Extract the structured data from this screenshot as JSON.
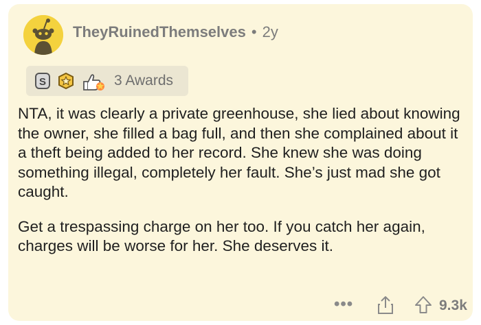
{
  "comment": {
    "author": "TheyRuinedThemselves",
    "separator": "•",
    "age": "2y",
    "awards_label": "3 Awards",
    "paragraphs": [
      "NTA, it was clearly a private greenhouse, she lied about knowing the owner, she filled a bag full, and then she complained about it a theft being added to her record. She knew she was doing something illegal, completely her fault. She’s just mad she got caught.",
      "Get a trespassing charge on her too. If you catch her again, charges will be worse for her. She deserves it."
    ],
    "more_label": "•••",
    "score": "9.3k"
  },
  "colors": {
    "card_background": "#fcf6dc",
    "avatar_background": "#f4d23e",
    "awards_background": "#ebe6d2",
    "text": "#1f1f1f",
    "meta_text": "#7c7c7c"
  },
  "icons": [
    "snoo-avatar-icon",
    "silver-award-icon",
    "gold-award-icon",
    "helpful-award-icon",
    "share-icon",
    "upvote-icon"
  ]
}
